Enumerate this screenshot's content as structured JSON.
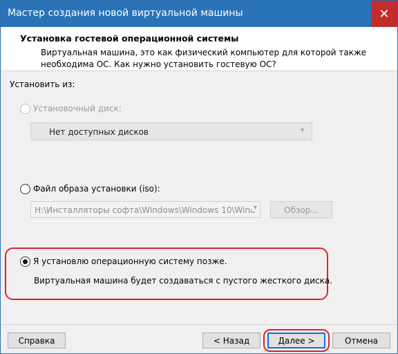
{
  "window": {
    "title": "Мастер создания новой виртуальной машины"
  },
  "header": {
    "title": "Установка гостевой операционной системы",
    "description": "Виртуальная машина, это как физический компьютер для которой также необходима ОС. Как нужно установить гостевую ОС?"
  },
  "install_from": {
    "label": "Установить из:"
  },
  "options": {
    "disc": {
      "label": "Установочный диск:",
      "selected": false,
      "enabled": false,
      "dropdown_value": "Нет доступных дисков"
    },
    "iso": {
      "label": "Файл образа установки (iso):",
      "selected": false,
      "enabled": true,
      "path_value": "H:\\Инсталляторы софта\\Windows\\Windows 10\\Wind",
      "browse_label": "Обзор..."
    },
    "later": {
      "label": "Я установлю операционную систему позже.",
      "selected": true,
      "enabled": true,
      "hint": "Виртуальная машина будет создаваться с пустого жесткого диска."
    }
  },
  "footer": {
    "help_label": "Справка",
    "back_label": "< Назад",
    "next_label": "Далее >",
    "cancel_label": "Отмена"
  },
  "colors": {
    "titlebar": "#2b73b8",
    "close_button": "#c42b2b",
    "highlight_annotation": "#e0202a",
    "default_button_border": "#0078d7"
  },
  "icons": {
    "close": "close-icon",
    "dropdown": "chevron-down-icon"
  }
}
